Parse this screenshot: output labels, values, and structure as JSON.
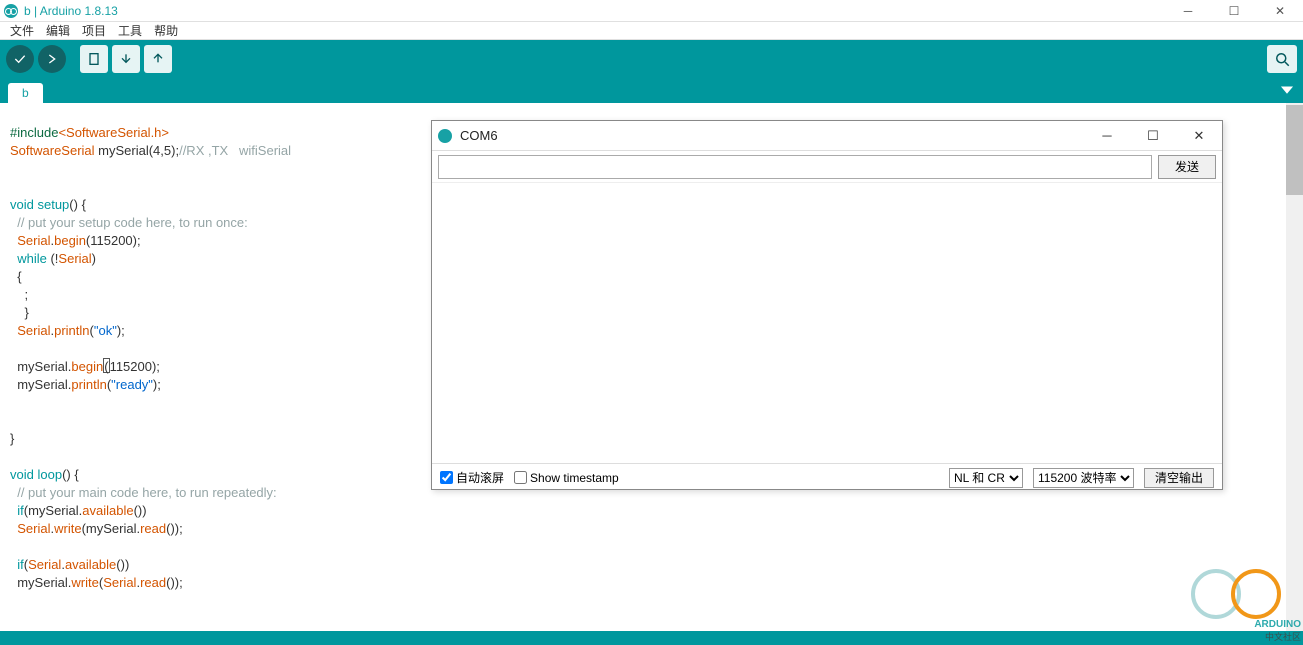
{
  "window": {
    "title": "b | Arduino 1.8.13",
    "controls": {
      "min": "─",
      "max": "☐",
      "close": "✕"
    }
  },
  "menu": [
    "文件",
    "编辑",
    "项目",
    "工具",
    "帮助"
  ],
  "toolbar_icons": [
    "verify",
    "upload",
    "new",
    "open",
    "save"
  ],
  "tab": "b",
  "code": {
    "l1a": "#include",
    "l1b": "<SoftwareSerial.h>",
    "l2a": "SoftwareSerial",
    "l2b": " mySerial(4,5);",
    "l2c": "//RX ,TX   wifiSerial",
    "blank1": "",
    "blank2": "",
    "l5a": "void",
    "l5b": " ",
    "l5c": "setup",
    "l5d": "() {",
    "l6": "  // put your setup code here, to run once:",
    "l7a": "  ",
    "l7b": "Serial",
    "l7c": ".",
    "l7d": "begin",
    "l7e": "(115200);",
    "l8a": "  ",
    "l8b": "while",
    "l8c": " (!",
    "l8d": "Serial",
    "l8e": ")",
    "l9": "  {",
    "l10": "    ;",
    "l11": "    }",
    "l12a": "  ",
    "l12b": "Serial",
    "l12c": ".",
    "l12d": "println",
    "l12e": "(",
    "l12f": "\"ok\"",
    "l12g": ");",
    "blank3": "",
    "l14a": "  mySerial.",
    "l14b": "begin",
    "l14c": "(",
    "l14d": "1",
    "l14e": "15200);",
    "l15a": "  mySerial.",
    "l15b": "println",
    "l15c": "(",
    "l15d": "\"ready\"",
    "l15e": ");",
    "blank4": "",
    "blank5": "",
    "l18": "}",
    "blank6": "",
    "l20a": "void",
    "l20b": " ",
    "l20c": "loop",
    "l20d": "() {",
    "l21": "  // put your main code here, to run repeatedly:",
    "l22a": "  ",
    "l22b": "if",
    "l22c": "(mySerial.",
    "l22d": "available",
    "l22e": "())",
    "l23a": "  ",
    "l23b": "Serial",
    "l23c": ".",
    "l23d": "write",
    "l23e": "(mySerial.",
    "l23f": "read",
    "l23g": "());",
    "blank7": "",
    "l25a": "  ",
    "l25b": "if",
    "l25c": "(",
    "l25d": "Serial",
    "l25e": ".",
    "l25f": "available",
    "l25g": "())",
    "l26a": "  mySerial.",
    "l26b": "write",
    "l26c": "(",
    "l26d": "Serial",
    "l26e": ".",
    "l26f": "read",
    "l26g": "());"
  },
  "serial_monitor": {
    "title": "COM6",
    "send": "发送",
    "input_value": "",
    "autoscroll": "自动滚屏",
    "show_ts": "Show timestamp",
    "line_ending": "NL 和 CR",
    "baud": "115200 波特率",
    "clear": "清空输出",
    "controls": {
      "min": "─",
      "max": "☐",
      "close": "✕"
    }
  },
  "watermark": {
    "brand": "ARDUINO",
    "sub": "中文社区"
  }
}
